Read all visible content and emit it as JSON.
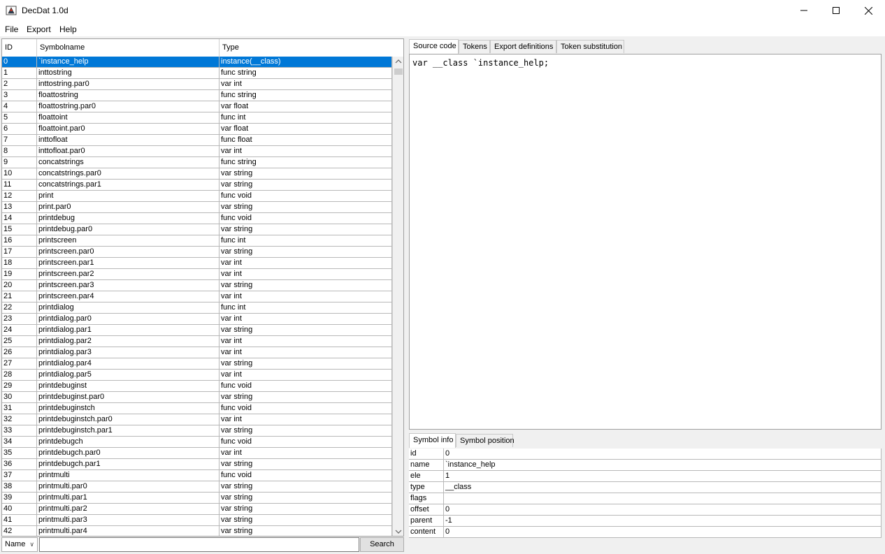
{
  "window": {
    "title": "DecDat 1.0d"
  },
  "menu": [
    "File",
    "Export",
    "Help"
  ],
  "table": {
    "columns": [
      "ID",
      "Symbolname",
      "Type"
    ],
    "rows": [
      [
        "0",
        "`instance_help",
        "instance(__class)"
      ],
      [
        "1",
        "inttostring",
        "func string"
      ],
      [
        "2",
        "inttostring.par0",
        "var int"
      ],
      [
        "3",
        "floattostring",
        "func string"
      ],
      [
        "4",
        "floattostring.par0",
        "var float"
      ],
      [
        "5",
        "floattoint",
        "func int"
      ],
      [
        "6",
        "floattoint.par0",
        "var float"
      ],
      [
        "7",
        "inttofloat",
        "func float"
      ],
      [
        "8",
        "inttofloat.par0",
        "var int"
      ],
      [
        "9",
        "concatstrings",
        "func string"
      ],
      [
        "10",
        "concatstrings.par0",
        "var string"
      ],
      [
        "11",
        "concatstrings.par1",
        "var string"
      ],
      [
        "12",
        "print",
        "func void"
      ],
      [
        "13",
        "print.par0",
        "var string"
      ],
      [
        "14",
        "printdebug",
        "func void"
      ],
      [
        "15",
        "printdebug.par0",
        "var string"
      ],
      [
        "16",
        "printscreen",
        "func int"
      ],
      [
        "17",
        "printscreen.par0",
        "var string"
      ],
      [
        "18",
        "printscreen.par1",
        "var int"
      ],
      [
        "19",
        "printscreen.par2",
        "var int"
      ],
      [
        "20",
        "printscreen.par3",
        "var string"
      ],
      [
        "21",
        "printscreen.par4",
        "var int"
      ],
      [
        "22",
        "printdialog",
        "func int"
      ],
      [
        "23",
        "printdialog.par0",
        "var int"
      ],
      [
        "24",
        "printdialog.par1",
        "var string"
      ],
      [
        "25",
        "printdialog.par2",
        "var int"
      ],
      [
        "26",
        "printdialog.par3",
        "var int"
      ],
      [
        "27",
        "printdialog.par4",
        "var string"
      ],
      [
        "28",
        "printdialog.par5",
        "var int"
      ],
      [
        "29",
        "printdebuginst",
        "func void"
      ],
      [
        "30",
        "printdebuginst.par0",
        "var string"
      ],
      [
        "31",
        "printdebuginstch",
        "func void"
      ],
      [
        "32",
        "printdebuginstch.par0",
        "var int"
      ],
      [
        "33",
        "printdebuginstch.par1",
        "var string"
      ],
      [
        "34",
        "printdebugch",
        "func void"
      ],
      [
        "35",
        "printdebugch.par0",
        "var int"
      ],
      [
        "36",
        "printdebugch.par1",
        "var string"
      ],
      [
        "37",
        "printmulti",
        "func void"
      ],
      [
        "38",
        "printmulti.par0",
        "var string"
      ],
      [
        "39",
        "printmulti.par1",
        "var string"
      ],
      [
        "40",
        "printmulti.par2",
        "var string"
      ],
      [
        "41",
        "printmulti.par3",
        "var string"
      ],
      [
        "42",
        "printmulti.par4",
        "var string"
      ]
    ],
    "selected_index": 0
  },
  "search": {
    "mode": "Name",
    "value": "",
    "button": "Search"
  },
  "editor_tabs": [
    "Source code",
    "Tokens",
    "Export definitions",
    "Token substitution"
  ],
  "source_code": "var __class `instance_help;",
  "info_tabs": [
    "Symbol info",
    "Symbol position"
  ],
  "symbol_info": [
    {
      "key": "id",
      "value": "0"
    },
    {
      "key": "name",
      "value": "`instance_help"
    },
    {
      "key": "ele",
      "value": "1"
    },
    {
      "key": "type",
      "value": "__class"
    },
    {
      "key": "flags",
      "value": ""
    },
    {
      "key": "offset",
      "value": "0"
    },
    {
      "key": "parent",
      "value": "-1"
    },
    {
      "key": "content",
      "value": "0"
    }
  ],
  "colors": {
    "selection": "#0078d7",
    "background": "#f0f0f0"
  },
  "icons": [
    "app-icon",
    "minimize-icon",
    "maximize-icon",
    "close-icon",
    "chevron-down-icon",
    "scroll-down-icon"
  ]
}
